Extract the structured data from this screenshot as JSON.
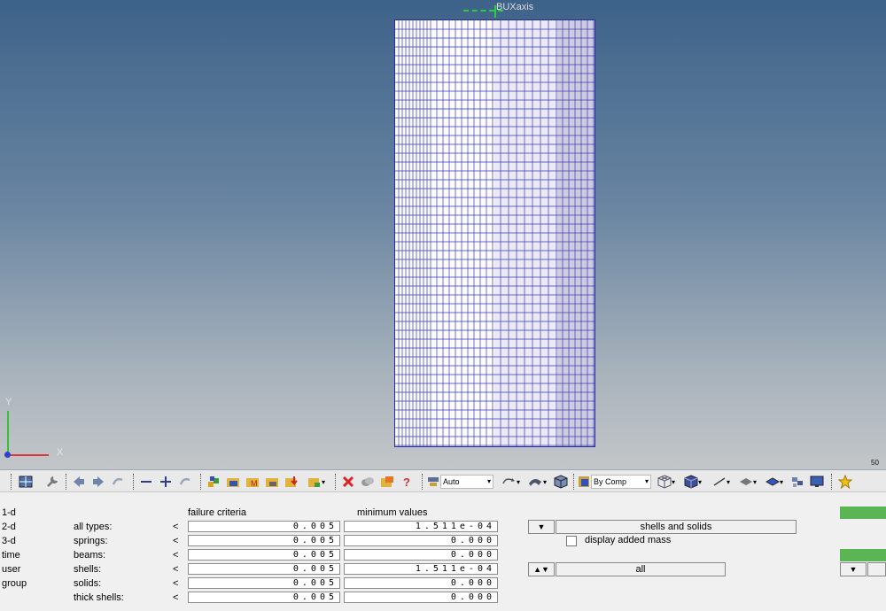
{
  "viewport": {
    "axis_top_label": "BUXaxis",
    "axis_x": "X",
    "axis_y": "Y",
    "scale_label": "50"
  },
  "toolbar": {
    "auto_select": "Auto",
    "by_comp_select": "By Comp"
  },
  "panel": {
    "menu": [
      "1-d",
      "2-d",
      "3-d",
      "time",
      "user",
      "group"
    ],
    "headers": {
      "failure_criteria": "failure criteria",
      "minimum_values": "minimum values"
    },
    "rows": [
      {
        "label": "all types:",
        "failure": "0.005",
        "minimum": "1.511e-04"
      },
      {
        "label": "springs:",
        "failure": "0.005",
        "minimum": "0.000"
      },
      {
        "label": "beams:",
        "failure": "0.005",
        "minimum": "0.000"
      },
      {
        "label": "shells:",
        "failure": "0.005",
        "minimum": "1.511e-04"
      },
      {
        "label": "solids:",
        "failure": "0.005",
        "minimum": "0.000"
      },
      {
        "label": "thick shells:",
        "failure": "0.005",
        "minimum": "0.000"
      }
    ],
    "row_arrow": "<",
    "shells_solids_button": "shells and solids",
    "display_added_mass_label": "display added mass",
    "all_button": "all"
  }
}
